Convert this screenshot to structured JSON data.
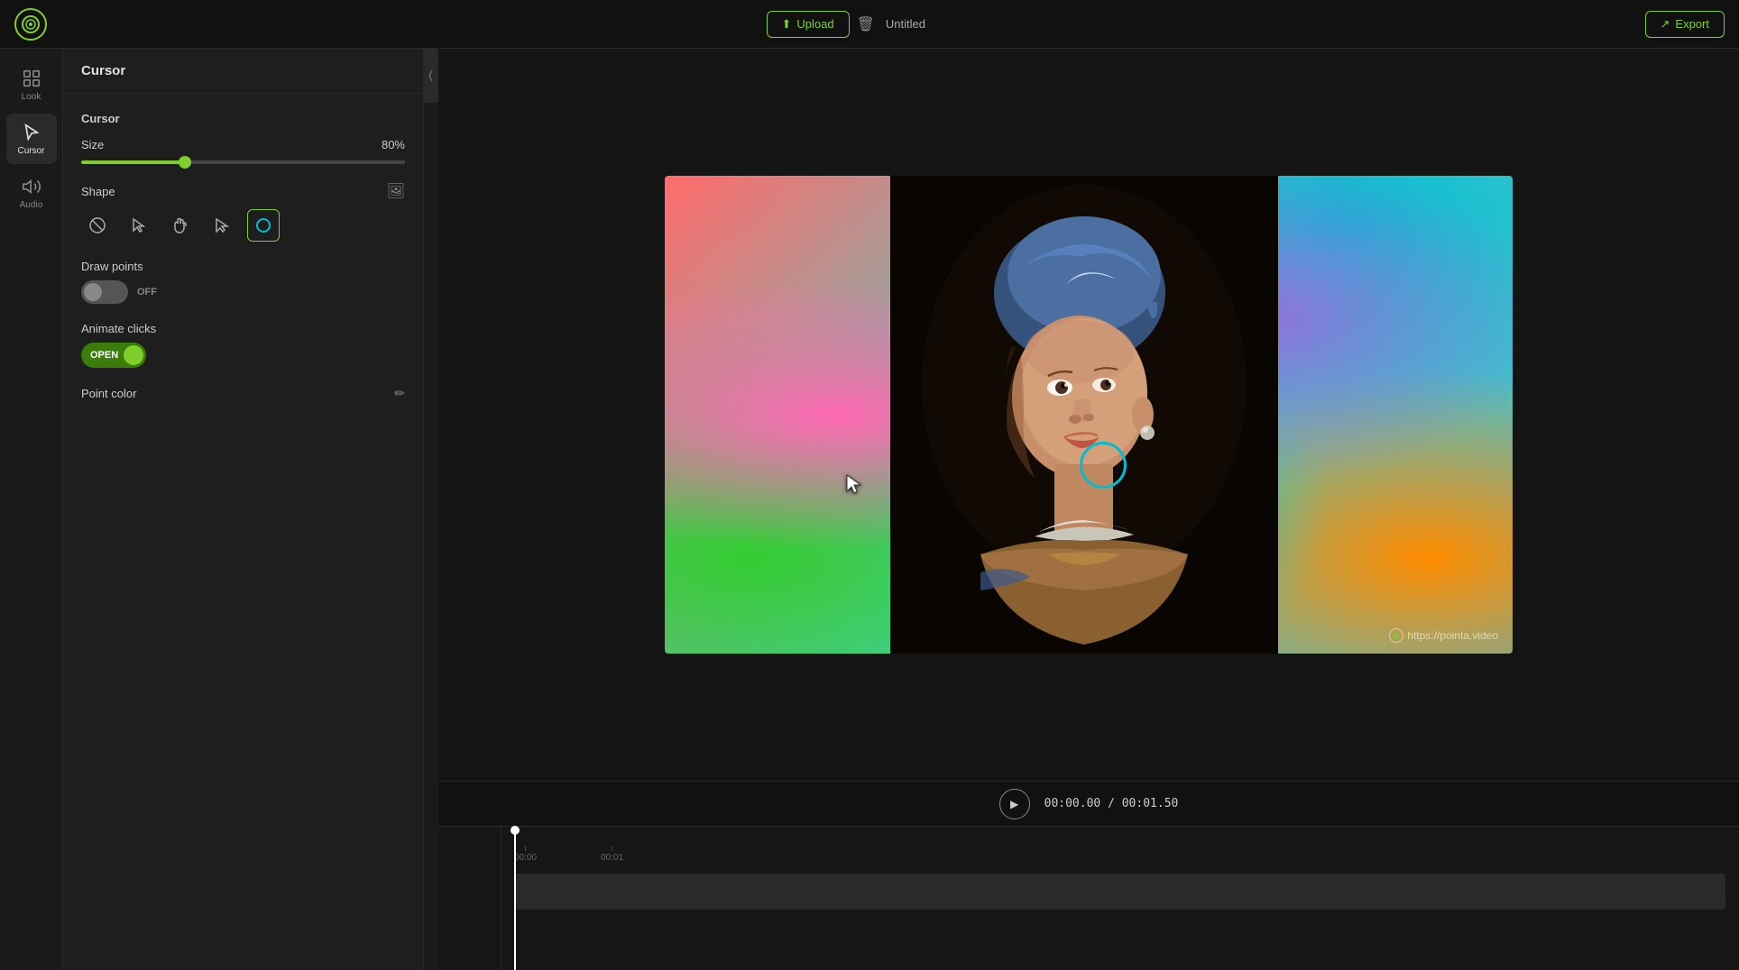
{
  "app": {
    "logo_symbol": "◉",
    "title": "Cursor"
  },
  "topbar": {
    "upload_label": "Upload",
    "export_label": "Export",
    "doc_title": "Untitled",
    "upload_icon": "↑",
    "export_icon": "↗",
    "trash_icon": "🗑"
  },
  "nav": {
    "items": [
      {
        "id": "look",
        "label": "Look",
        "icon": "look"
      },
      {
        "id": "cursor",
        "label": "Cursor",
        "icon": "cursor",
        "active": true
      },
      {
        "id": "audio",
        "label": "Audio",
        "icon": "audio"
      }
    ]
  },
  "panel": {
    "header": "Cursor",
    "cursor_section": {
      "title": "Cursor",
      "size_label": "Size",
      "size_value": "80%",
      "slider_percent": 32,
      "shape_label": "Shape",
      "shape_image_icon": "🖼",
      "shapes": [
        {
          "id": "none",
          "symbol": "⊘",
          "active": false
        },
        {
          "id": "arrow",
          "symbol": "↖",
          "active": false
        },
        {
          "id": "hand",
          "symbol": "☛",
          "active": false
        },
        {
          "id": "pointer",
          "symbol": "↗",
          "active": false
        },
        {
          "id": "circle",
          "symbol": "○",
          "active": true
        }
      ]
    },
    "draw_points": {
      "label": "Draw points",
      "toggle_state": "OFF",
      "toggle_on": false
    },
    "animate_clicks": {
      "label": "Animate clicks",
      "toggle_state": "OPEN",
      "toggle_on": true
    },
    "point_color": {
      "label": "Point color",
      "edit_icon": "✏"
    }
  },
  "video": {
    "cursor_visible": true,
    "watermark_text": "https://pointa.video",
    "watermark_icon": "◉"
  },
  "playback": {
    "play_icon": "▶",
    "current_time": "00:00.00",
    "separator": "/",
    "total_time": "00:01.50"
  },
  "timeline": {
    "ticks": [
      {
        "label": "00:00",
        "pos": 14
      },
      {
        "label": "00:01",
        "pos": 110
      }
    ]
  }
}
